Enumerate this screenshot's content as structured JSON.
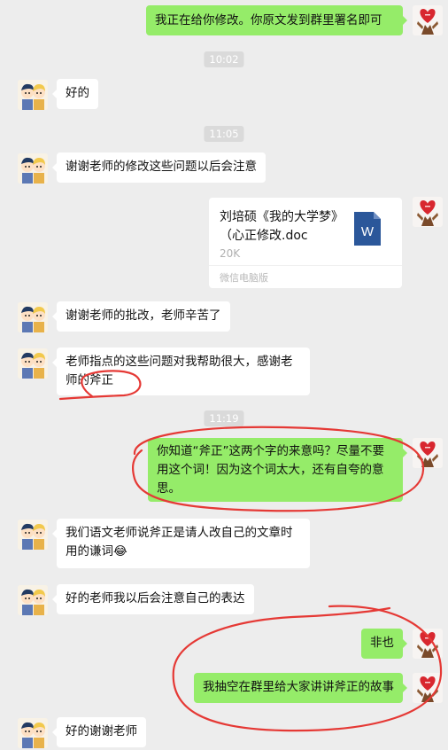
{
  "messages": {
    "m1": {
      "text": "我正在给你修改。你原文发到群里署名即可"
    },
    "t1": {
      "text": "10:02"
    },
    "m2": {
      "text": "好的"
    },
    "t2": {
      "text": "11:05"
    },
    "m3": {
      "text": "谢谢老师的修改这些问题以后会注意"
    },
    "file": {
      "title": "刘培硕《我的大学梦》（心正修改.doc",
      "size": "20K",
      "source": "微信电脑版",
      "icon_letter": "W"
    },
    "m4": {
      "text": "谢谢老师的批改，老师辛苦了"
    },
    "m5": {
      "text": "老师指点的这些问题对我帮助很大，感谢老师的斧正"
    },
    "t3": {
      "text": "11:19"
    },
    "m6": {
      "text": "你知道“斧正”这两个字的来意吗？尽量不要用这个词！因为这个词太大，还有自夸的意思。"
    },
    "m7": {
      "text": "我们语文老师说斧正是请人改自己的文章时用的谦词😂"
    },
    "m8": {
      "text": "好的老师我以后会注意自己的表达"
    },
    "m9": {
      "text": "非也"
    },
    "m10": {
      "text": "我抽空在群里给大家讲讲斧正的故事"
    },
    "m11": {
      "text": "好的谢谢老师"
    }
  },
  "colors": {
    "outgoing": "#95ec69",
    "incoming": "#ffffff",
    "background": "#ededed",
    "annotation": "#e53935",
    "word_icon": "#2b579a"
  },
  "icons": {
    "teacher_avatar": "heart-hands-avatar",
    "student_avatar": "cartoon-kids-avatar"
  }
}
